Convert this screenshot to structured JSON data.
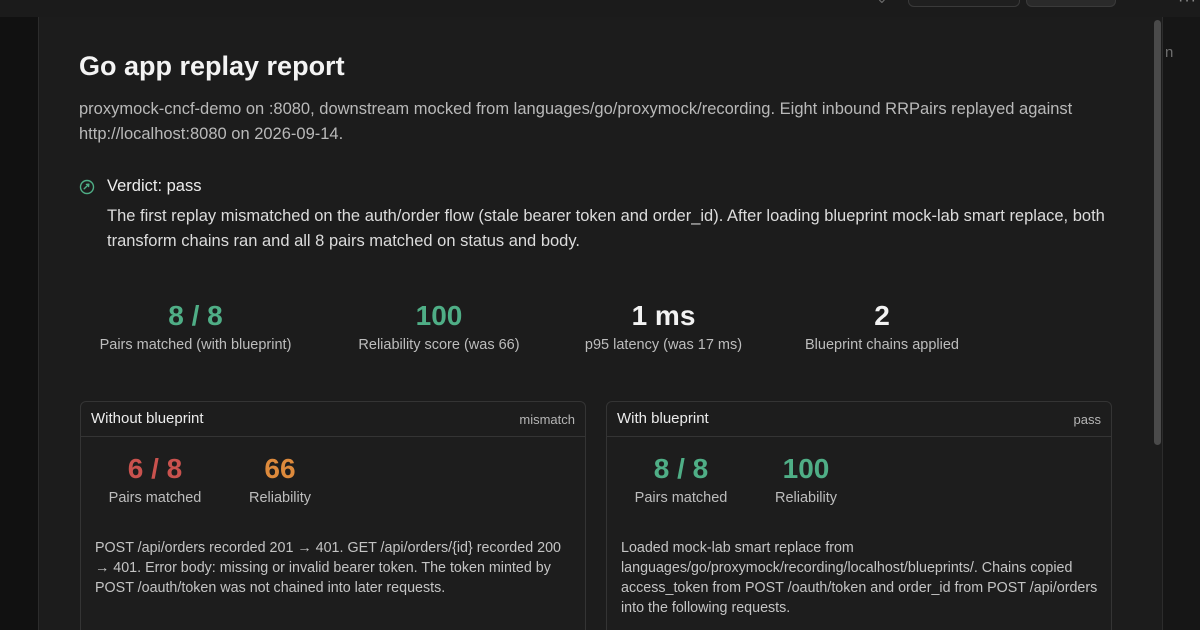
{
  "report": {
    "title": "Go app replay report",
    "subtitle": "proxymock-cncf-demo on :8080, downstream mocked from languages/go/proxymock/recording. Eight inbound RRPairs replayed against http://localhost:8080 on 2026-09-14."
  },
  "verdict": {
    "icon": "link-circle-icon",
    "title": "Verdict: pass",
    "body": "The first replay mismatched on the auth/order flow (stale bearer token and order_id). After loading blueprint mock-lab smart replace, both transform chains ran and all 8 pairs matched on status and body."
  },
  "stats": [
    {
      "value": "8 / 8",
      "label": "Pairs matched (with blueprint)",
      "color": "#4fae86"
    },
    {
      "value": "100",
      "label": "Reliability score (was 66)",
      "color": "#4fae86"
    },
    {
      "value": "1 ms",
      "label": "p95 latency (was 17 ms)",
      "color": "#f2f2f2"
    },
    {
      "value": "2",
      "label": "Blueprint chains applied",
      "color": "#f2f2f2"
    }
  ],
  "cards": {
    "without": {
      "title": "Without blueprint",
      "tag": "mismatch",
      "pairs_value": "6 / 8",
      "pairs_label": "Pairs matched",
      "reliability_value": "66",
      "reliability_label": "Reliability",
      "body": "POST /api/orders recorded 201 → 401. GET /api/orders/{id} recorded 200 → 401. Error body: missing or invalid bearer token. The token minted by POST /oauth/token was not chained into later requests."
    },
    "with": {
      "title": "With blueprint",
      "tag": "pass",
      "pairs_value": "8 / 8",
      "pairs_label": "Pairs matched",
      "reliability_value": "100",
      "reliability_label": "Reliability",
      "body": "Loaded mock-lab smart replace from languages/go/proxymock/recording/localhost/blueprints/. Chains copied access_token from POST /oauth/token and order_id from POST /api/orders into the following requests."
    }
  },
  "colors": {
    "success": "#4fae86",
    "error": "#c9524e",
    "warning": "#dd8a3c",
    "background": "#1c1c1c"
  },
  "chrome": {
    "menu_icon": "more-dots-icon",
    "right_strip_letter": "n"
  }
}
